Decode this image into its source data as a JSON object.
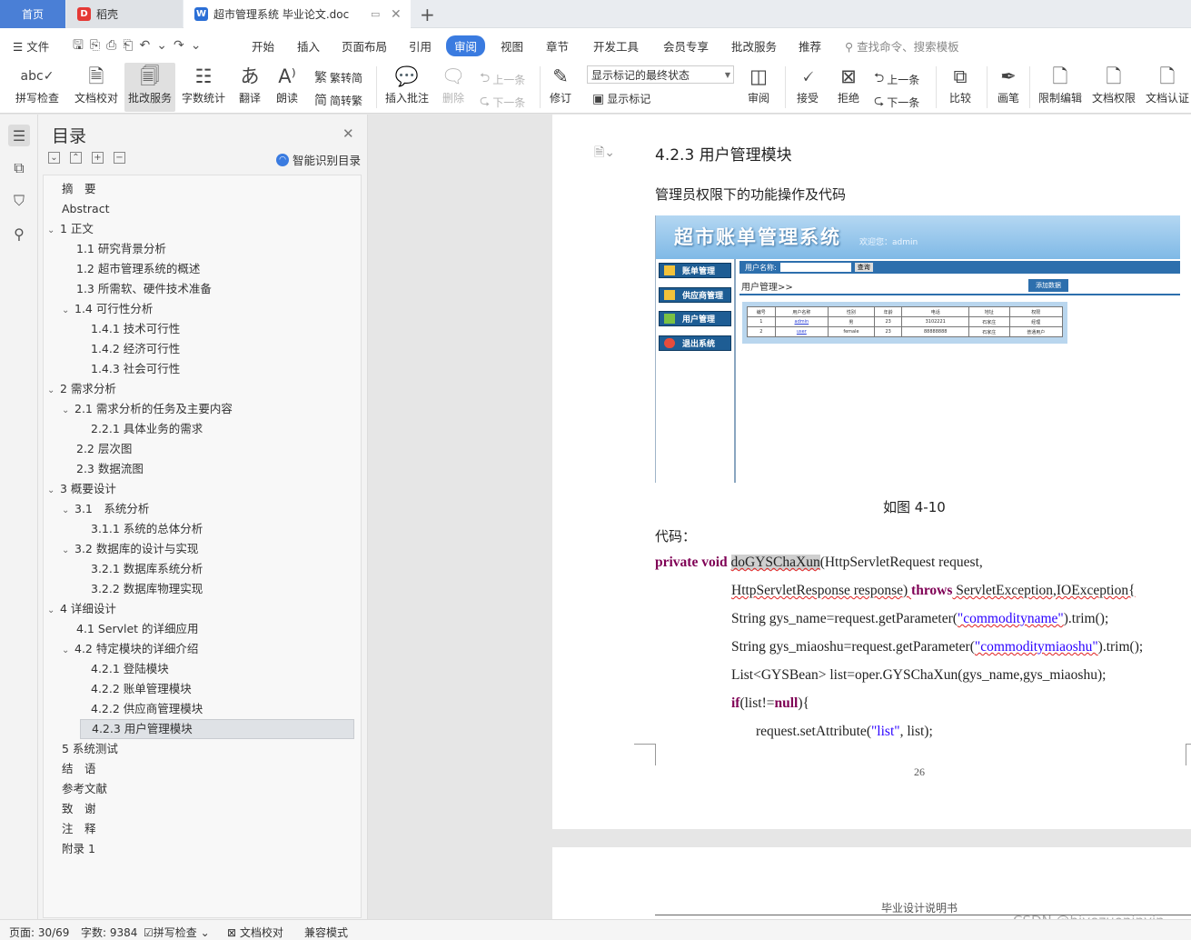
{
  "tabs": {
    "home": "首页",
    "daoke": "稻壳",
    "doc": "超市管理系统 毕业论文.doc"
  },
  "menu": {
    "file": "文件",
    "items": [
      "开始",
      "插入",
      "页面布局",
      "引用",
      "审阅",
      "视图",
      "章节",
      "开发工具",
      "会员专享",
      "批改服务",
      "推荐"
    ],
    "search": "查找命令、搜索模板"
  },
  "ribbon": {
    "spellcheck": "拼写检查",
    "proofread": "文档校对",
    "correction": "批改服务",
    "wordcount": "字数统计",
    "translate": "翻译",
    "read": "朗读",
    "trad": "繁转简",
    "simp": "简转繁",
    "insert_comment": "插入批注",
    "delete": "删除",
    "prev": "上一条",
    "next": "下一条",
    "revise": "修订",
    "markup_state": "显示标记的最终状态",
    "show_markup": "显示标记",
    "review": "审阅",
    "accept": "接受",
    "reject": "拒绝",
    "prev2": "上一条",
    "next2": "下一条",
    "compare": "比较",
    "pen": "画笔",
    "restrict": "限制编辑",
    "permission": "文档权限",
    "certify": "文档认证"
  },
  "toc": {
    "title": "目录",
    "smart": "智能识别目录",
    "items": [
      {
        "text": "摘　要"
      },
      {
        "text": "Abstract"
      },
      {
        "text": "1  正文"
      },
      {
        "text": "1.1 研究背景分析"
      },
      {
        "text": "1.2  超市管理系统的概述"
      },
      {
        "text": "1.3 所需软、硬件技术准备"
      },
      {
        "text": "1.4 可行性分析"
      },
      {
        "text": "1.4.1  技术可行性"
      },
      {
        "text": "1.4.2  经济可行性"
      },
      {
        "text": "1.4.3  社会可行性"
      },
      {
        "text": "2  需求分析"
      },
      {
        "text": "2.1  需求分析的任务及主要内容"
      },
      {
        "text": "2.2.1  具体业务的需求"
      },
      {
        "text": "2.2  层次图"
      },
      {
        "text": "2.3 数据流图"
      },
      {
        "text": "3  概要设计"
      },
      {
        "text": "3.1　系统分析"
      },
      {
        "text": "3.1.1  系统的总体分析"
      },
      {
        "text": "3.2  数据库的设计与实现"
      },
      {
        "text": "3.2.1  数据库系统分析"
      },
      {
        "text": "3.2.2  数据库物理实现"
      },
      {
        "text": "4  详细设计"
      },
      {
        "text": "4.1 Servlet 的详细应用"
      },
      {
        "text": "4.2  特定模块的详细介绍"
      },
      {
        "text": "4.2.1  登陆模块"
      },
      {
        "text": "4.2.2  账单管理模块"
      },
      {
        "text": "4.2.2  供应商管理模块"
      },
      {
        "text": "4.2.3  用户管理模块"
      },
      {
        "text": "5  系统测试"
      },
      {
        "text": "结　语"
      },
      {
        "text": "参考文献"
      },
      {
        "text": "致　谢"
      },
      {
        "text": "注　释"
      },
      {
        "text": "附录 1"
      }
    ]
  },
  "doc": {
    "heading": "4.2.3  用户管理模块",
    "para": "管理员权限下的功能操作及代码",
    "shot": {
      "title": "超市账单管理系统",
      "welcome": "欢迎您：admin",
      "nav": [
        "账单管理",
        "供应商管理",
        "用户管理",
        "退出系统"
      ],
      "user_label": "用户名称:",
      "query": "查询",
      "section": "用户管理>>",
      "add": "添加数据",
      "headers": [
        "编号",
        "用户名称",
        "性别",
        "年龄",
        "电话",
        "地址",
        "权限"
      ],
      "rows": [
        [
          "1",
          "admin",
          "男",
          "23",
          "3102221",
          "石家庄",
          "经理"
        ],
        [
          "2",
          "user",
          "female",
          "23",
          "88888888",
          "石家庄",
          "普通用户"
        ]
      ]
    },
    "caption": "如图  4-10",
    "code_label": "代码：",
    "code": {
      "l1a": "private void",
      "l1b": "doGYSChaXun",
      "l1c": "(HttpServletRequest request,",
      "l2a": "HttpServletResponse response) ",
      "l2b": "throws",
      "l2c": " ServletException,IOException{",
      "l3a": "String gys_name=request.getParameter(",
      "l3b": "\"commodityname\"",
      "l3c": ").trim();",
      "l4a": "String gys_miaoshu=request.getParameter(",
      "l4b": "\"commoditymiaoshu\"",
      "l4c": ").trim();",
      "l5": "List<GYSBean> list=oper.GYSChaXun(gys_name,gys_miaoshu);",
      "l6a": "if",
      "l6b": "(list!=",
      "l6c": "null",
      "l6d": "){",
      "l7a": "request.setAttribute(",
      "l7b": "\"list\"",
      "l7c": ", list);"
    },
    "page_number": "26",
    "footer": "毕业设计说明书"
  },
  "status": {
    "page": "页面: 30/69",
    "words": "字数: 9384",
    "spell": "拼写检查",
    "proof": "文档校对",
    "compat": "兼容模式"
  },
  "watermark": "CSDN @biyezuopinvip"
}
